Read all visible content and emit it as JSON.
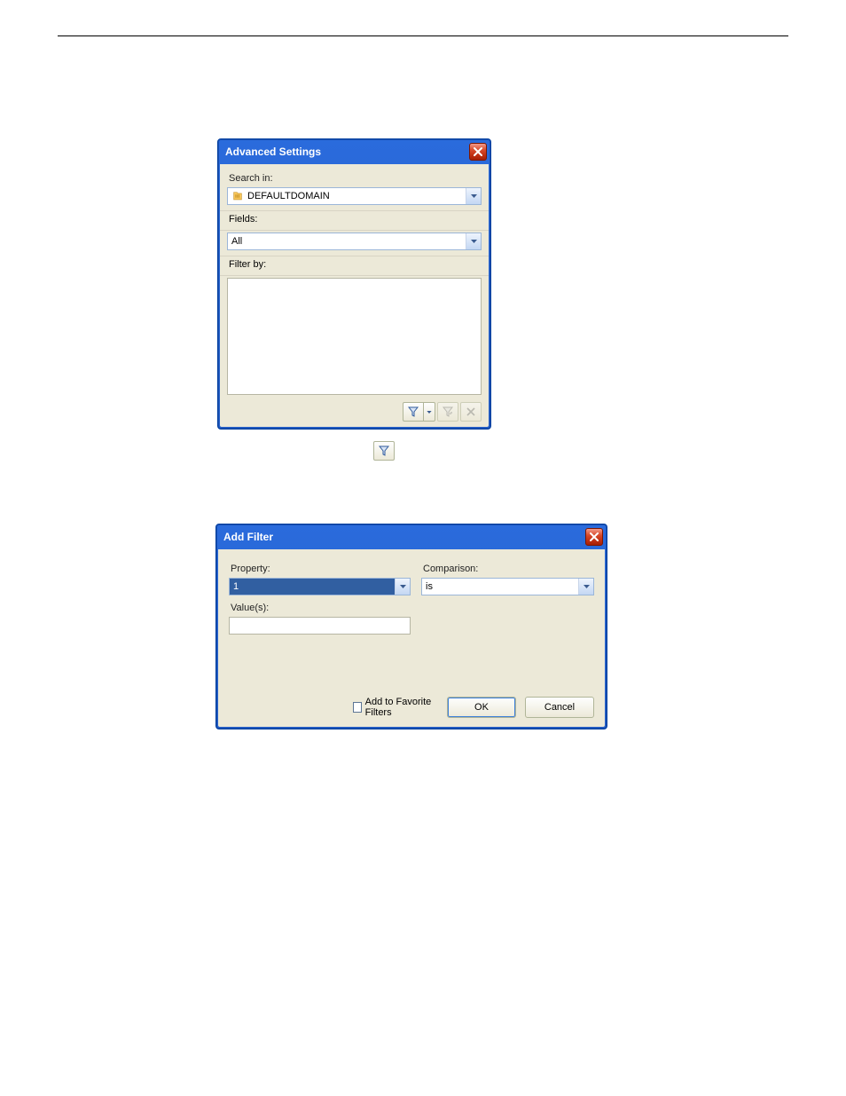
{
  "advancedWindow": {
    "title": "Advanced Settings",
    "searchInLabel": "Search in:",
    "searchInValue": "DEFAULTDOMAIN",
    "fieldsLabel": "Fields:",
    "fieldsValue": "All",
    "filterByLabel": "Filter by:"
  },
  "addFilterWindow": {
    "title": "Add Filter",
    "propertyLabel": "Property:",
    "propertyValue": "1",
    "comparisonLabel": "Comparison:",
    "comparisonValue": "is",
    "valuesLabel": "Value(s):",
    "valuesValue": "",
    "favoriteLabel": "Add to Favorite Filters",
    "okLabel": "OK",
    "cancelLabel": "Cancel"
  }
}
